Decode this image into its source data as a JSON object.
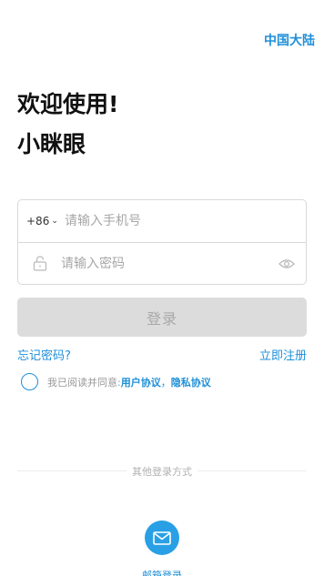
{
  "header": {
    "region": "中国大陆"
  },
  "welcome": {
    "line1": "欢迎使用!",
    "line2": "小眯眼"
  },
  "form": {
    "country_code": "+86",
    "phone_placeholder": "请输入手机号",
    "password_placeholder": "请输入密码"
  },
  "login_button": "登录",
  "links": {
    "forgot": "忘记密码?",
    "register": "立即注册"
  },
  "agreement": {
    "prefix": "我已阅读并同意:",
    "user_agreement": "用户协议",
    "separator": "，",
    "privacy_agreement": "隐私协议"
  },
  "other_login": {
    "label": "其他登录方式",
    "email_label": "邮箱登录",
    "email_icon": "mail-icon"
  },
  "colors": {
    "accent": "#1e8fd8",
    "button_disabled": "#dcdcdc"
  }
}
